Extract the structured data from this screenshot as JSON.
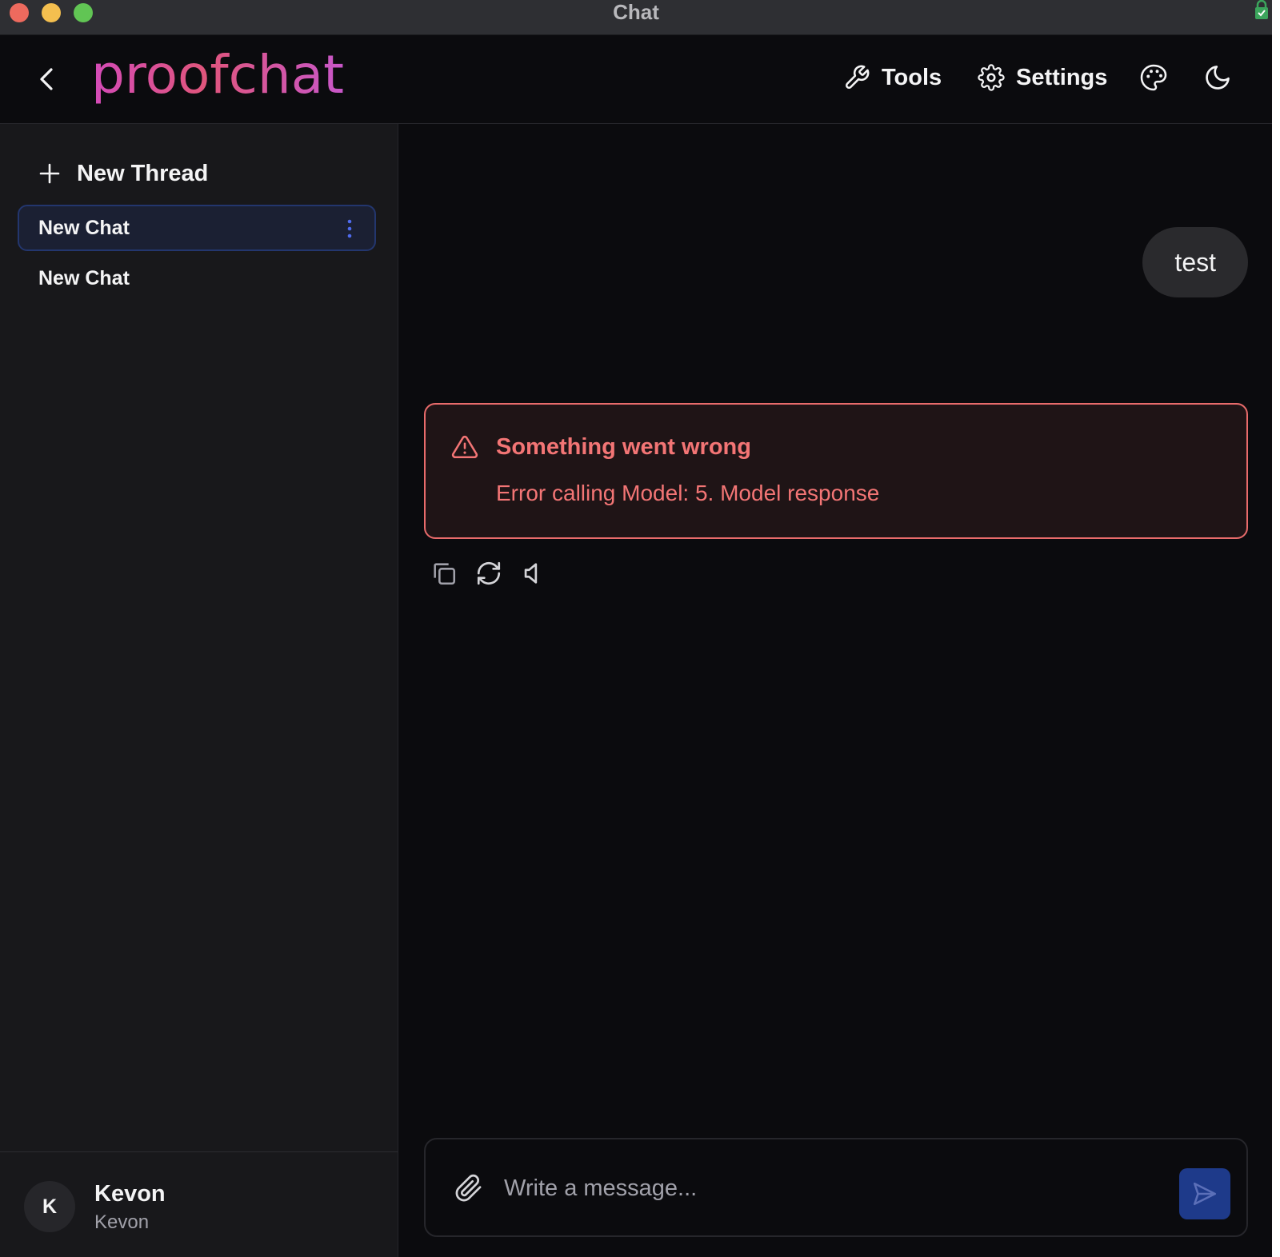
{
  "window": {
    "title": "Chat"
  },
  "header": {
    "logo": "proofchat",
    "tools_label": "Tools",
    "settings_label": "Settings",
    "icons": [
      "back-arrow-icon",
      "wrench-icon",
      "gear-icon",
      "palette-icon",
      "moon-icon"
    ]
  },
  "sidebar": {
    "new_thread_label": "New Thread",
    "threads": [
      {
        "label": "New Chat",
        "active": true
      },
      {
        "label": "New Chat",
        "active": false
      }
    ],
    "user": {
      "initial": "K",
      "name": "Kevon",
      "subtitle": "Kevon"
    }
  },
  "chat": {
    "messages": [
      {
        "role": "user",
        "text": "test"
      }
    ],
    "error": {
      "title": "Something went wrong",
      "detail": "Error calling Model: 5. Model response"
    },
    "actions": [
      "copy-icon",
      "regenerate-icon",
      "speaker-icon"
    ]
  },
  "composer": {
    "placeholder": "Write a message...",
    "value": ""
  },
  "colors": {
    "background": "#0b0b0e",
    "sidebar": "#18181b",
    "accent": "#1e3a8a",
    "error": "#f37575",
    "logo_gradient": [
      "#d44bb8",
      "#e0557c"
    ]
  }
}
